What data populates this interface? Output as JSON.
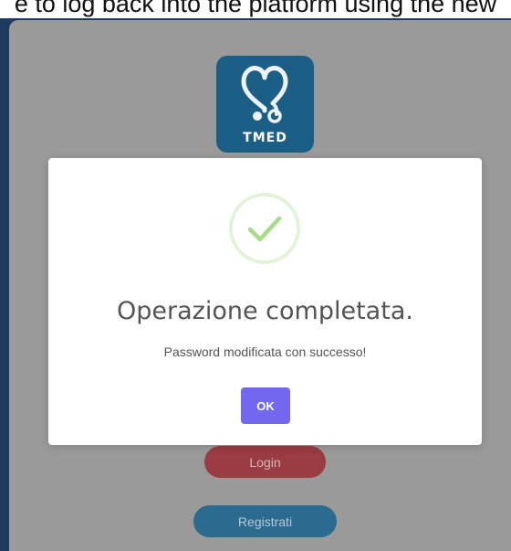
{
  "caption": {
    "text": "e to log back into the platform using the new"
  },
  "logo": {
    "text": "TMED"
  },
  "modal": {
    "title": "Operazione completata.",
    "message": "Password modificata con successo!",
    "ok_label": "OK",
    "accent_color": "#7367f0",
    "success_color": "#a5dc86"
  },
  "buttons": {
    "login_label": "Login",
    "register_label": "Registrati"
  },
  "colors": {
    "frame": "#1c3b5e",
    "overlay_background": "#9a9a9a",
    "login_button": "#9a3c42",
    "register_button": "#2b6b8f",
    "logo_background": "#1c5f86"
  },
  "icons": [
    "stethoscope-heart-icon",
    "success-checkmark-icon"
  ]
}
